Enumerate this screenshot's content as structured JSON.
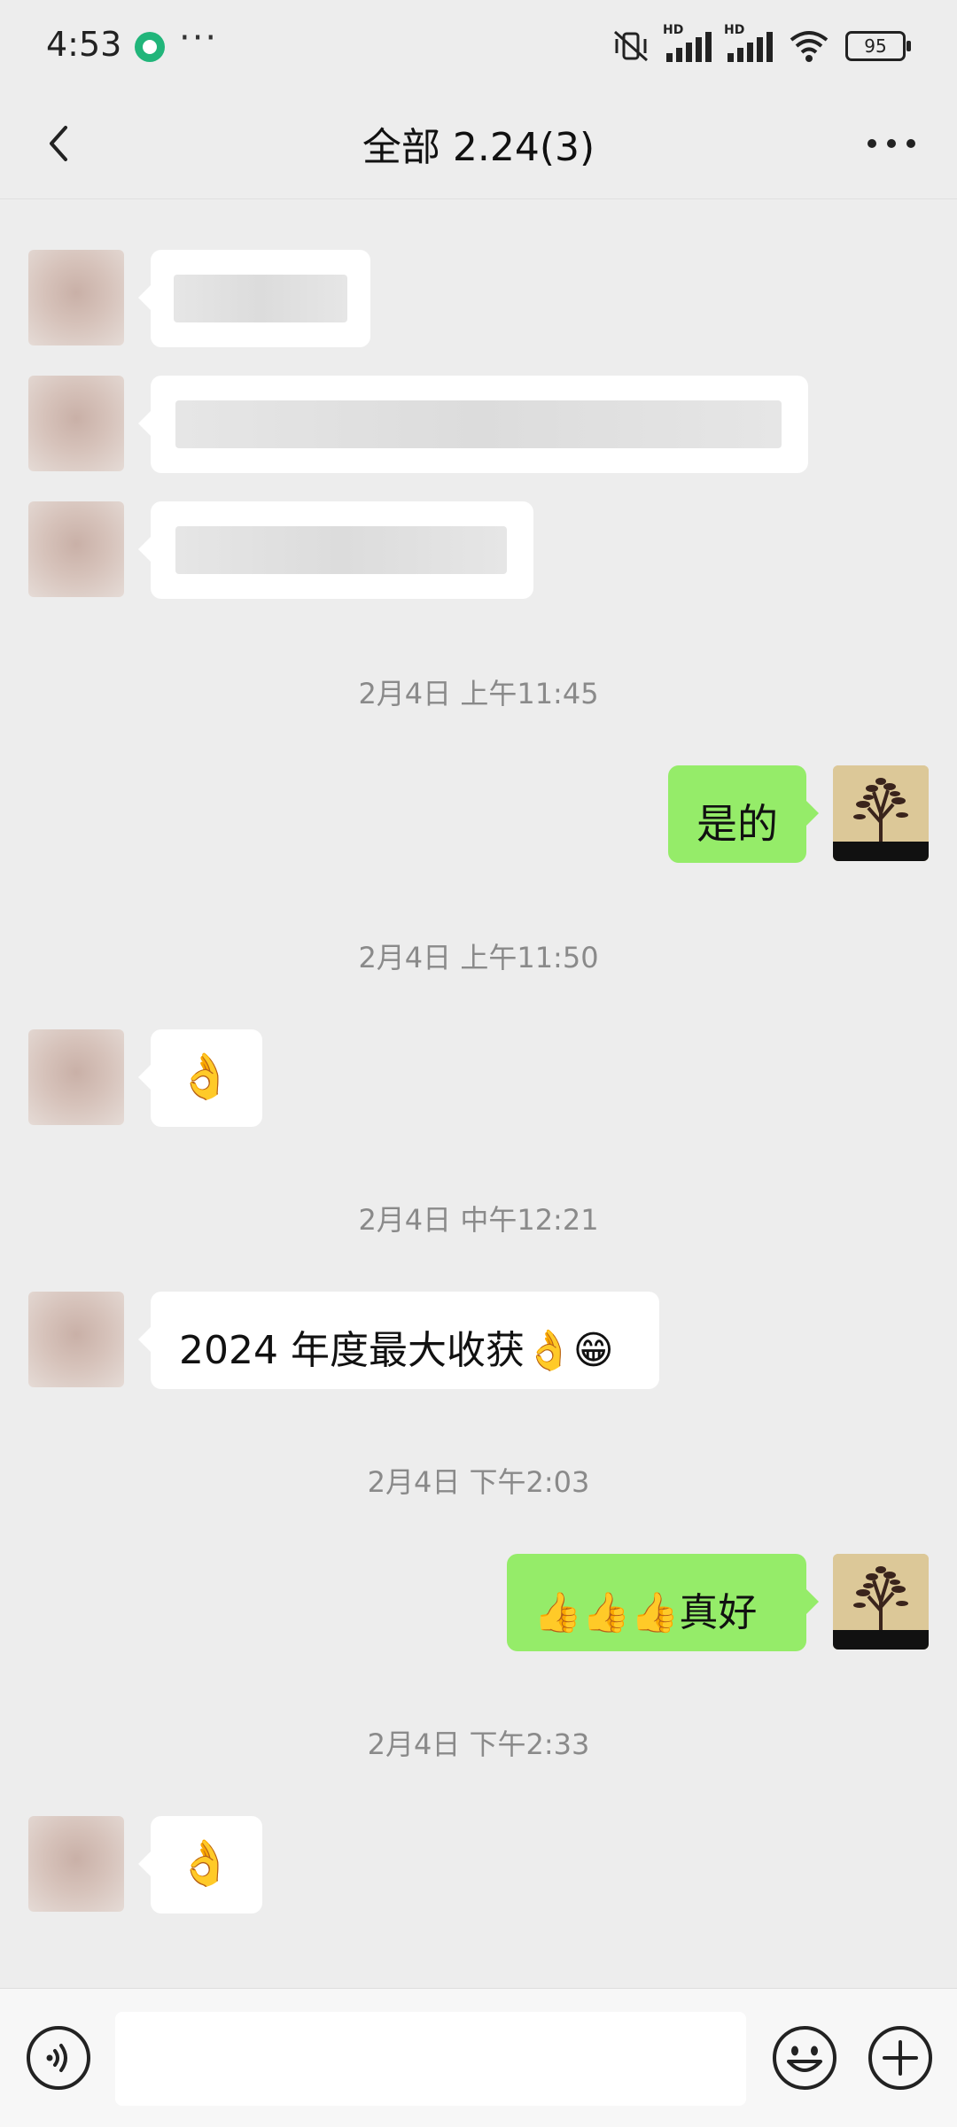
{
  "status_bar": {
    "time": "4:53",
    "dots": "···",
    "battery": "95",
    "hd_label": "HD"
  },
  "header": {
    "title": "全部 2.24(3)"
  },
  "messages": {
    "ts1": "2月4日 上午11:45",
    "me1": "是的",
    "ts2": "2月4日 上午11:50",
    "other1": "👌",
    "ts3": "2月4日 中午12:21",
    "other2": "2024 年度最大收获👌😁",
    "ts4": "2月4日 下午2:03",
    "me2": "👍👍👍真好",
    "ts5": "2月4日 下午2:33",
    "other3": "👌"
  },
  "composer": {
    "value": ""
  },
  "colors": {
    "background": "#ededed",
    "my_bubble": "#95ec69",
    "other_bubble": "#ffffff",
    "timestamp_text": "#8a8a8a"
  },
  "icons": [
    "back-arrow",
    "more-dots",
    "voice",
    "emoji",
    "plus"
  ]
}
